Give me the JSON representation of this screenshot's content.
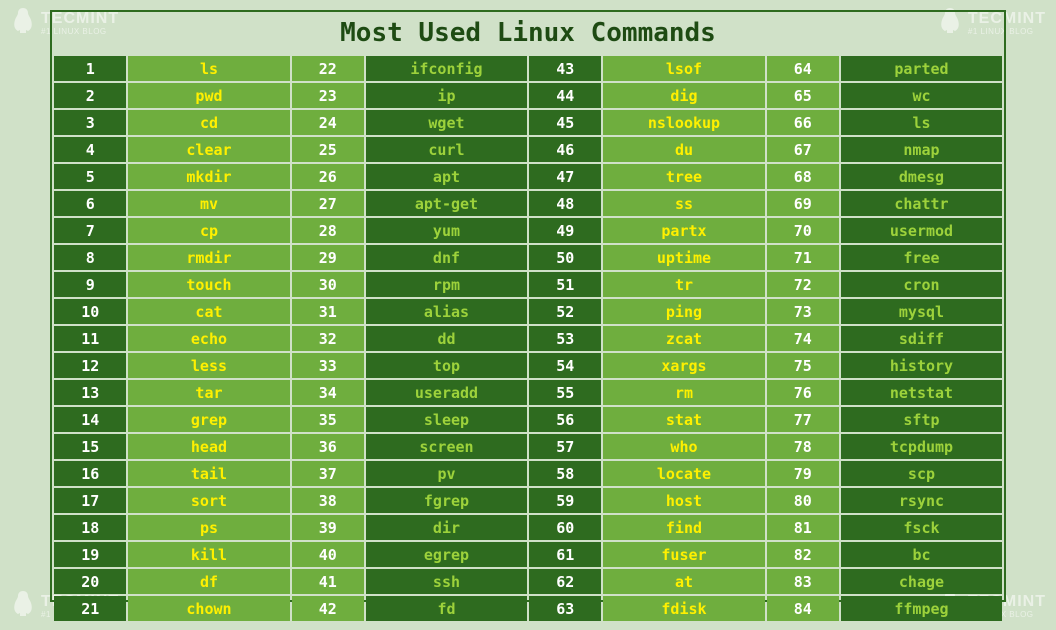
{
  "title": "Most Used Linux Commands",
  "watermark": {
    "brand": "TECMINT",
    "tagline": "#1 LINUX BLOG"
  },
  "commands": [
    {
      "n": 1,
      "c": "ls"
    },
    {
      "n": 2,
      "c": "pwd"
    },
    {
      "n": 3,
      "c": "cd"
    },
    {
      "n": 4,
      "c": "clear"
    },
    {
      "n": 5,
      "c": "mkdir"
    },
    {
      "n": 6,
      "c": "mv"
    },
    {
      "n": 7,
      "c": "cp"
    },
    {
      "n": 8,
      "c": "rmdir"
    },
    {
      "n": 9,
      "c": "touch"
    },
    {
      "n": 10,
      "c": "cat"
    },
    {
      "n": 11,
      "c": "echo"
    },
    {
      "n": 12,
      "c": "less"
    },
    {
      "n": 13,
      "c": "tar"
    },
    {
      "n": 14,
      "c": "grep"
    },
    {
      "n": 15,
      "c": "head"
    },
    {
      "n": 16,
      "c": "tail"
    },
    {
      "n": 17,
      "c": "sort"
    },
    {
      "n": 18,
      "c": "ps"
    },
    {
      "n": 19,
      "c": "kill"
    },
    {
      "n": 20,
      "c": "df"
    },
    {
      "n": 21,
      "c": "chown"
    },
    {
      "n": 22,
      "c": "ifconfig"
    },
    {
      "n": 23,
      "c": "ip"
    },
    {
      "n": 24,
      "c": "wget"
    },
    {
      "n": 25,
      "c": "curl"
    },
    {
      "n": 26,
      "c": "apt"
    },
    {
      "n": 27,
      "c": "apt-get"
    },
    {
      "n": 28,
      "c": "yum"
    },
    {
      "n": 29,
      "c": "dnf"
    },
    {
      "n": 30,
      "c": "rpm"
    },
    {
      "n": 31,
      "c": "alias"
    },
    {
      "n": 32,
      "c": "dd"
    },
    {
      "n": 33,
      "c": "top"
    },
    {
      "n": 34,
      "c": "useradd"
    },
    {
      "n": 35,
      "c": "sleep"
    },
    {
      "n": 36,
      "c": "screen"
    },
    {
      "n": 37,
      "c": "pv"
    },
    {
      "n": 38,
      "c": "fgrep"
    },
    {
      "n": 39,
      "c": "dir"
    },
    {
      "n": 40,
      "c": "egrep"
    },
    {
      "n": 41,
      "c": "ssh"
    },
    {
      "n": 42,
      "c": "fd"
    },
    {
      "n": 43,
      "c": "lsof"
    },
    {
      "n": 44,
      "c": "dig"
    },
    {
      "n": 45,
      "c": "nslookup"
    },
    {
      "n": 46,
      "c": "du"
    },
    {
      "n": 47,
      "c": "tree"
    },
    {
      "n": 48,
      "c": "ss"
    },
    {
      "n": 49,
      "c": "partx"
    },
    {
      "n": 50,
      "c": "uptime"
    },
    {
      "n": 51,
      "c": "tr"
    },
    {
      "n": 52,
      "c": "ping"
    },
    {
      "n": 53,
      "c": "zcat"
    },
    {
      "n": 54,
      "c": "xargs"
    },
    {
      "n": 55,
      "c": "rm"
    },
    {
      "n": 56,
      "c": "stat"
    },
    {
      "n": 57,
      "c": "who"
    },
    {
      "n": 58,
      "c": "locate"
    },
    {
      "n": 59,
      "c": "host"
    },
    {
      "n": 60,
      "c": "find"
    },
    {
      "n": 61,
      "c": "fuser"
    },
    {
      "n": 62,
      "c": "at"
    },
    {
      "n": 63,
      "c": "fdisk"
    },
    {
      "n": 64,
      "c": "parted"
    },
    {
      "n": 65,
      "c": "wc"
    },
    {
      "n": 66,
      "c": "ls"
    },
    {
      "n": 67,
      "c": "nmap"
    },
    {
      "n": 68,
      "c": "dmesg"
    },
    {
      "n": 69,
      "c": "chattr"
    },
    {
      "n": 70,
      "c": "usermod"
    },
    {
      "n": 71,
      "c": "free"
    },
    {
      "n": 72,
      "c": "cron"
    },
    {
      "n": 73,
      "c": "mysql"
    },
    {
      "n": 74,
      "c": "sdiff"
    },
    {
      "n": 75,
      "c": "history"
    },
    {
      "n": 76,
      "c": "netstat"
    },
    {
      "n": 77,
      "c": "sftp"
    },
    {
      "n": 78,
      "c": "tcpdump"
    },
    {
      "n": 79,
      "c": "scp"
    },
    {
      "n": 80,
      "c": "rsync"
    },
    {
      "n": 81,
      "c": "fsck"
    },
    {
      "n": 82,
      "c": "bc"
    },
    {
      "n": 83,
      "c": "chage"
    },
    {
      "n": 84,
      "c": "ffmpeg"
    }
  ]
}
